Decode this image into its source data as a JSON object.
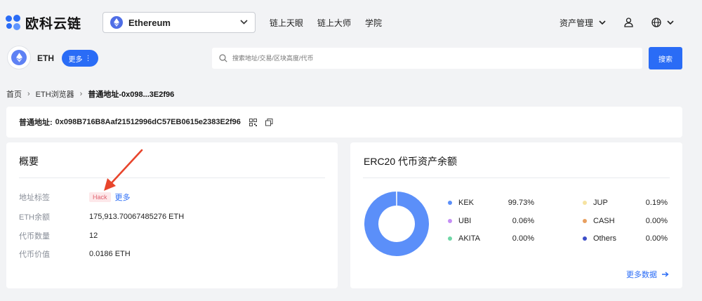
{
  "header": {
    "logo_text": "欧科云链",
    "chain_select": "Ethereum",
    "nav": [
      "链上天眼",
      "链上大师",
      "学院"
    ],
    "asset_menu": "资产管理"
  },
  "subbar": {
    "coin": "ETH",
    "more_label": "更多",
    "search_placeholder": "搜索地址/交易/区块高度/代币",
    "search_button": "搜索"
  },
  "breadcrumb": [
    "首页",
    "ETH浏览器",
    "普通地址-0x098...3E2f96"
  ],
  "address": {
    "label": "普通地址:",
    "value": "0x098B716B8Aaf21512996dC57EB0615e2383E2f96"
  },
  "overview": {
    "title": "概要",
    "rows": [
      {
        "key": "地址标签",
        "tag": "Hack",
        "more": "更多"
      },
      {
        "key": "ETH余额",
        "value": "175,913.70067485276 ETH"
      },
      {
        "key": "代币数量",
        "value": "12"
      },
      {
        "key": "代币价值",
        "value": "0.0186 ETH"
      }
    ]
  },
  "erc20": {
    "title": "ERC20 代币资产余额",
    "legend": [
      {
        "name": "KEK",
        "pct": "99.73%",
        "color": "#5b8ff9",
        "share": 99.73
      },
      {
        "name": "JUP",
        "pct": "0.19%",
        "color": "#f6e3a1",
        "share": 0.19
      },
      {
        "name": "UBI",
        "pct": "0.06%",
        "color": "#c48ef5",
        "share": 0.06
      },
      {
        "name": "CASH",
        "pct": "0.00%",
        "color": "#e8a060",
        "share": 0.0
      },
      {
        "name": "AKITA",
        "pct": "0.00%",
        "color": "#6fd7a6",
        "share": 0.0
      },
      {
        "name": "Others",
        "pct": "0.00%",
        "color": "#3d4ec8",
        "share": 0.0
      }
    ],
    "more_data": "更多数据"
  },
  "colors": {
    "accent": "#2a6cf6",
    "danger": "#e0626f"
  }
}
